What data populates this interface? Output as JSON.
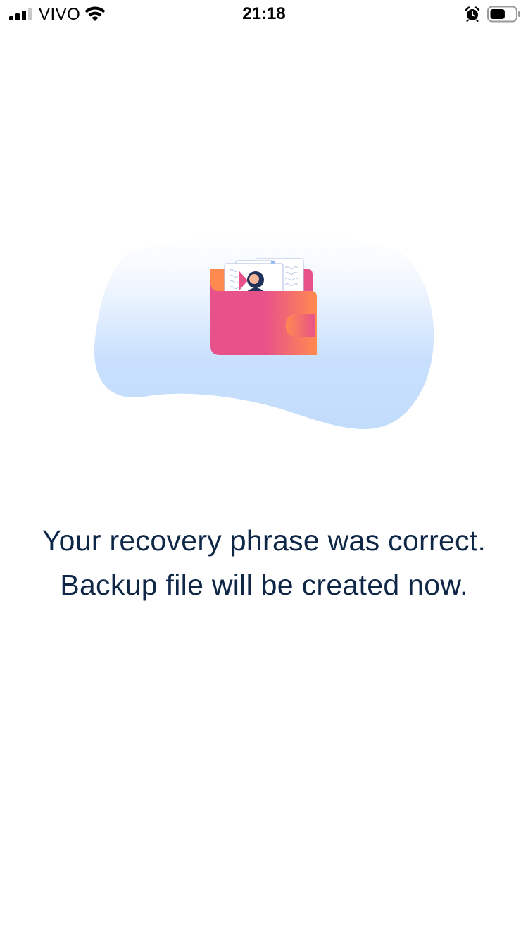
{
  "status_bar": {
    "carrier": "VIVO",
    "time": "21:18",
    "signal_icon": "cellular-signal-icon",
    "wifi_icon": "wifi-icon",
    "alarm_icon": "alarm-clock-icon",
    "battery_icon": "battery-icon",
    "signal_bars_active": 3,
    "signal_bars_total": 4,
    "battery_level": 0.6
  },
  "illustration": {
    "icon": "wallet-with-id-cards-icon",
    "colors": {
      "blob_top": "#f7fbff",
      "blob_bottom": "#c4defd",
      "wallet_pink": "#e8528a",
      "wallet_orange": "#ff8a50",
      "card_outline": "#b9c8e8",
      "avatar_dark": "#20325a"
    }
  },
  "message": {
    "line1": "Your recovery phrase was correct.",
    "line2": "Backup file will be created now.",
    "color": "#0f2747"
  }
}
